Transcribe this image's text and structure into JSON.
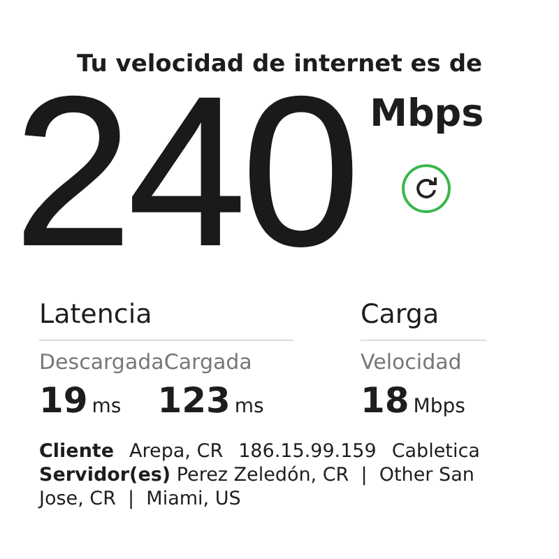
{
  "headline": "Tu velocidad de internet es de",
  "speed": {
    "value": "240",
    "unit": "Mbps"
  },
  "groups": [
    {
      "title": "Latencia",
      "subtitles": [
        "Descargada",
        "Cargada"
      ],
      "values": [
        {
          "number": "19",
          "unit": "ms"
        },
        {
          "number": "123",
          "unit": "ms"
        }
      ]
    },
    {
      "title": "Carga",
      "subtitles": [
        "Velocidad"
      ],
      "values": [
        {
          "number": "18",
          "unit": "Mbps"
        }
      ]
    }
  ],
  "client": {
    "label": "Cliente",
    "items": [
      "Arepa, CR",
      "186.15.99.159",
      "Cabletica"
    ]
  },
  "servers": {
    "label": "Servidor(es)",
    "text": "Perez Zeledón, CR  |  Other San Jose, CR  |  Miami, US"
  }
}
